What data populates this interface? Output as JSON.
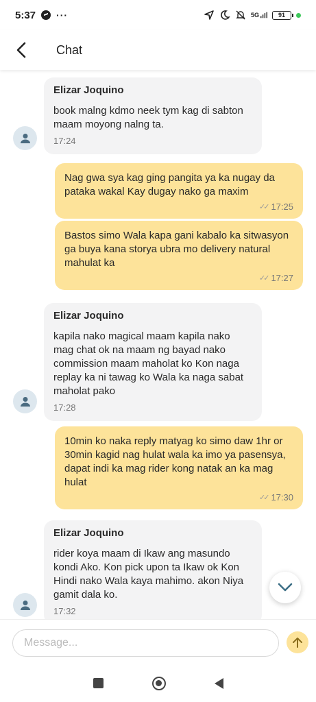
{
  "status_bar": {
    "time": "5:37",
    "dots": "···",
    "network": "5G",
    "battery": "91",
    "icons": [
      "messenger-icon",
      "location-arrow-icon",
      "moon-icon",
      "mute-icon",
      "signal-icon",
      "battery-icon"
    ]
  },
  "header": {
    "title": "Chat"
  },
  "messages": [
    {
      "sender": "Elizar Joquino",
      "text": "book malng kdmo neek tym kag di sabton maam moyong nalng ta.",
      "time": "17:24"
    },
    {
      "text": "Nag gwa sya kag ging pangita ya ka nugay da pataka wakal Kay dugay nako ga maxim",
      "time": "17:25"
    },
    {
      "text": "Bastos simo Wala kapa gani kabalo ka sitwasyon ga buya kana storya ubra mo delivery natural mahulat ka",
      "time": "17:27"
    },
    {
      "sender": "Elizar Joquino",
      "text": "kapila nako magical maam kapila nako mag chat ok na maam ng bayad nako commission maam maholat ko Kon naga replay ka ni tawag ko Wala ka naga sabat maholat pako",
      "time": "17:28"
    },
    {
      "text": "10min ko naka reply matyag ko simo daw 1hr or 30min kagid nag hulat wala ka imo ya pasensya, dapat indi ka mag rider kong natak an ka mag hulat",
      "time": "17:30"
    },
    {
      "sender": "Elizar Joquino",
      "text": "rider koya maam di Ikaw ang masundo kondi Ako. Kon pick upon ta Ikaw ok Kon Hindi nako Wala kaya mahimo. akon Niya gamit dala ko.",
      "time": "17:32"
    }
  ],
  "composer": {
    "placeholder": "Message..."
  },
  "colors": {
    "outgoing_bubble": "#fde39a",
    "incoming_bubble": "#f3f3f4",
    "avatar_bg": "#dde7ee",
    "avatar_fg": "#4a6b80"
  }
}
